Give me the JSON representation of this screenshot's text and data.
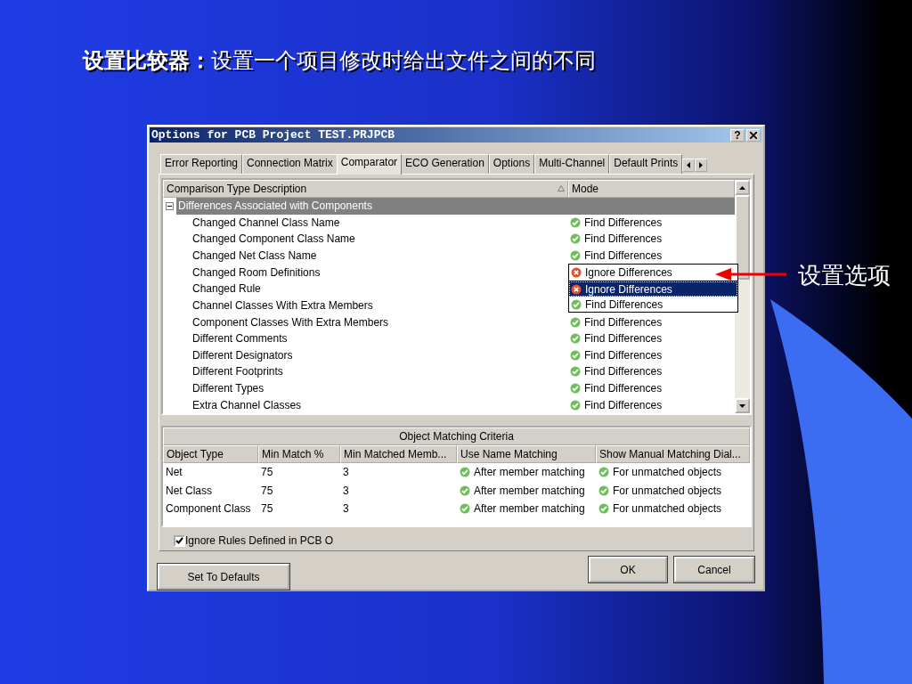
{
  "slide": {
    "title": "**设置比较器：**设置一个项目修改时给出文件之间的不同",
    "callout": "设置选项"
  },
  "dialog": {
    "title": "Options for PCB Project TEST.PRJPCB",
    "help_button": "?",
    "tabs": [
      {
        "label": "Error Reporting",
        "selected": false
      },
      {
        "label": "Connection Matrix",
        "selected": false
      },
      {
        "label": "Comparator",
        "selected": true
      },
      {
        "label": "ECO Generation",
        "selected": false
      },
      {
        "label": "Options",
        "selected": false
      },
      {
        "label": "Multi-Channel",
        "selected": false
      },
      {
        "label": "Default Prints",
        "selected": false
      }
    ],
    "comparison_table": {
      "columns": [
        "Comparison Type Description",
        "Mode"
      ],
      "group": {
        "label": "Differences Associated with Components",
        "expanded": true,
        "selected": true
      },
      "rows": [
        {
          "description": "Changed Channel Class Name",
          "mode": {
            "kind": "find",
            "label": "Find Differences"
          }
        },
        {
          "description": "Changed Component Class Name",
          "mode": {
            "kind": "find",
            "label": "Find Differences"
          }
        },
        {
          "description": "Changed Net Class Name",
          "mode": {
            "kind": "find",
            "label": "Find Differences"
          }
        },
        {
          "description": "Changed Room Definitions",
          "mode": {
            "kind": "ignore",
            "label": "Ignore Differences"
          },
          "editing": true
        },
        {
          "description": "Changed Rule"
        },
        {
          "description": "Channel Classes With Extra Members"
        },
        {
          "description": "Component Classes With Extra Members",
          "mode": {
            "kind": "find",
            "label": "Find Differences"
          }
        },
        {
          "description": "Different Comments",
          "mode": {
            "kind": "find",
            "label": "Find Differences"
          }
        },
        {
          "description": "Different Designators",
          "mode": {
            "kind": "find",
            "label": "Find Differences"
          }
        },
        {
          "description": "Different Footprints",
          "mode": {
            "kind": "find",
            "label": "Find Differences"
          }
        },
        {
          "description": "Different Types",
          "mode": {
            "kind": "find",
            "label": "Find Differences"
          }
        },
        {
          "description": "Extra Channel Classes",
          "mode": {
            "kind": "find",
            "label": "Find Differences"
          }
        }
      ],
      "dropdown": [
        {
          "kind": "ignore",
          "label": "Ignore Differences",
          "selected": true
        },
        {
          "kind": "find",
          "label": "Find Differences",
          "selected": false
        }
      ]
    },
    "matching": {
      "title": "Object Matching Criteria",
      "columns": [
        "Object Type",
        "Min Match %",
        "Min Matched Memb...",
        "Use Name Matching",
        "Show Manual Matching Dial..."
      ],
      "rows": [
        {
          "object_type": "Net",
          "min_match": "75",
          "min_members": "3",
          "name_matching": "After member matching",
          "manual_dialog": "For unmatched objects"
        },
        {
          "object_type": "Net Class",
          "min_match": "75",
          "min_members": "3",
          "name_matching": "After member matching",
          "manual_dialog": "For unmatched objects"
        },
        {
          "object_type": "Component Class",
          "min_match": "75",
          "min_members": "3",
          "name_matching": "After member matching",
          "manual_dialog": "For unmatched objects"
        }
      ]
    },
    "ignore_rules": {
      "label": "Ignore Rules Defined in PCB O",
      "checked": true
    },
    "buttons": {
      "defaults": "Set To Defaults",
      "ok": "OK",
      "cancel": "Cancel"
    }
  }
}
